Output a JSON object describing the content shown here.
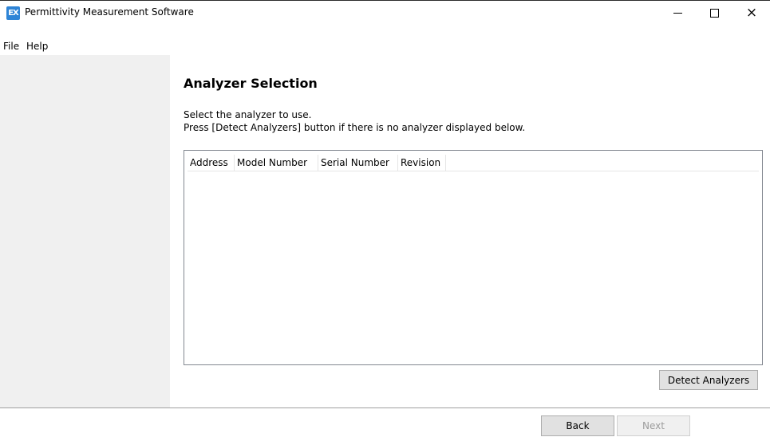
{
  "window": {
    "title": "Permittivity Measurement Software",
    "icon_text": "EX",
    "minimize_glyph": "minimize-icon",
    "maximize_glyph": "maximize-icon",
    "close_glyph": "×"
  },
  "menu": {
    "items": [
      {
        "label": "File"
      },
      {
        "label": "Help"
      }
    ]
  },
  "main": {
    "title": "Analyzer Selection",
    "description_line1": "Select the analyzer to use.",
    "description_line2": "Press [Detect Analyzers] button if there is no analyzer displayed below.",
    "table": {
      "columns": [
        "Address",
        "Model Number",
        "Serial Number",
        "Revision"
      ],
      "rows": []
    },
    "detect_button": "Detect Analyzers"
  },
  "footer": {
    "back_button": "Back",
    "next_button": "Next",
    "next_enabled": false
  },
  "colors": {
    "sidebar_bg": "#f0f0f0",
    "app_icon": "#2e84d6",
    "disabled_text": "#9c9c9c"
  }
}
